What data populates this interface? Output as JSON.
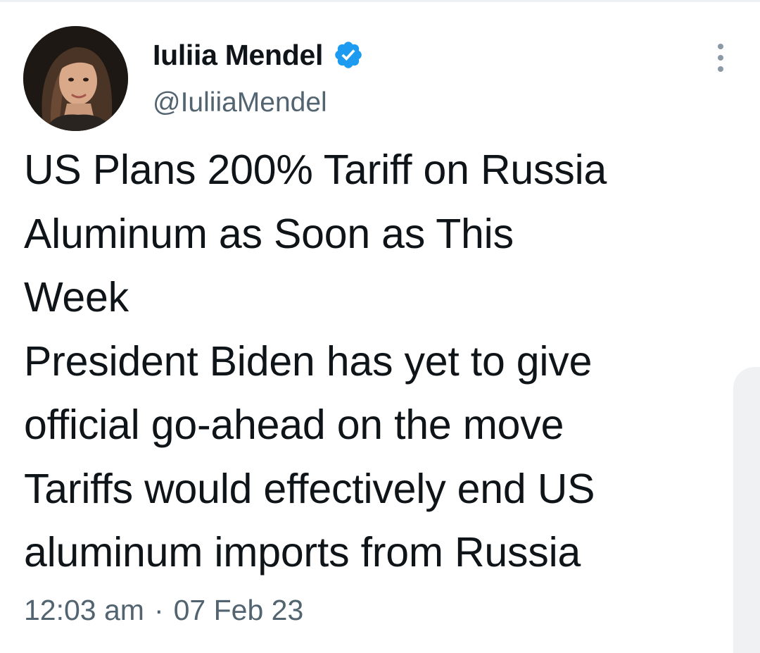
{
  "author": {
    "display_name": "Iuliia Mendel",
    "handle": "@IuliiaMendel",
    "verified": true
  },
  "tweet": {
    "lines": [
      "US Plans 200% Tariff on Russia",
      "Aluminum as Soon as This",
      "Week",
      "President Biden has yet to give",
      "official go-ahead on the move",
      "Tariffs would effectively end US",
      "aluminum imports from Russia"
    ],
    "time": "12:03 am",
    "separator": "·",
    "date": "07 Feb 23"
  },
  "colors": {
    "text_primary": "#0f1419",
    "text_secondary": "#536471",
    "verified_blue": "#1d9bf0"
  },
  "icons": {
    "verified": "verified-badge-icon",
    "more": "more-dots-icon"
  }
}
